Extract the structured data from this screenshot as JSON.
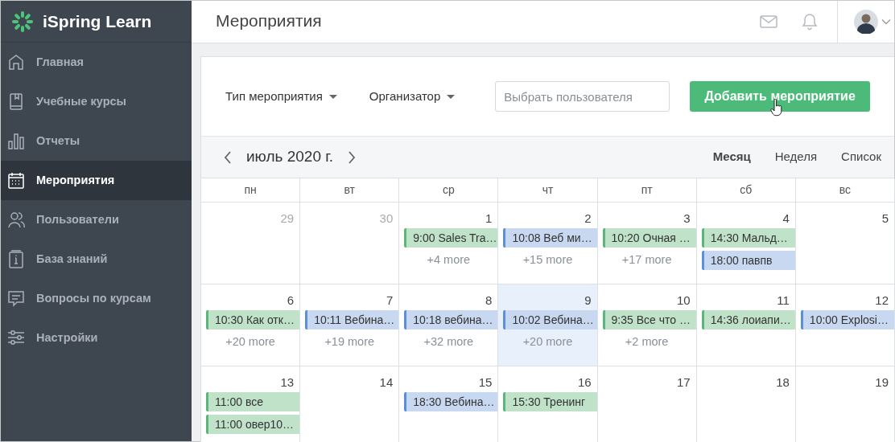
{
  "sidebar": {
    "logo": "iSpring Learn",
    "items": [
      {
        "label": "Главная",
        "selected": false
      },
      {
        "label": "Учебные курсы",
        "selected": false
      },
      {
        "label": "Отчеты",
        "selected": false
      },
      {
        "label": "Мероприятия",
        "selected": true
      },
      {
        "label": "Пользователи",
        "selected": false
      },
      {
        "label": "База знаний",
        "selected": false
      },
      {
        "label": "Вопросы по курсам",
        "selected": false
      },
      {
        "label": "Настройки",
        "selected": false
      }
    ]
  },
  "header": {
    "title": "Мероприятия"
  },
  "toolbar": {
    "filters": [
      {
        "label": "Тип мероприятия"
      },
      {
        "label": "Организатор"
      }
    ],
    "search": {
      "placeholder": "Выбрать пользователя"
    },
    "add_button": "Добавить мероприятие"
  },
  "calendar": {
    "month": "июль 2020 г.",
    "views": [
      {
        "label": "Месяц",
        "selected": true
      },
      {
        "label": "Неделя",
        "selected": false
      },
      {
        "label": "Список",
        "selected": false
      }
    ],
    "weekdays": [
      "пн",
      "вт",
      "ср",
      "чт",
      "пт",
      "сб",
      "вс"
    ],
    "weeks": [
      {
        "days": [
          {
            "number": "29",
            "other_month": true,
            "today": false
          },
          {
            "number": "30",
            "other_month": true,
            "today": false
          },
          {
            "number": "1",
            "other_month": false,
            "today": false,
            "events": [
              {
                "text": "9:00 Sales Tra…",
                "color": "#5cb57a"
              }
            ],
            "more": "+4 more"
          },
          {
            "number": "2",
            "other_month": false,
            "today": false,
            "events": [
              {
                "text": "10:08 Веб ми…",
                "color": "#5b8fd9"
              }
            ],
            "more": "+15 more"
          },
          {
            "number": "3",
            "other_month": false,
            "today": false,
            "events": [
              {
                "text": "10:20 Очная …",
                "color": "#5cb57a"
              }
            ],
            "more": "+17 more"
          },
          {
            "number": "4",
            "other_month": false,
            "today": false,
            "events": [
              {
                "text": "14:30 Мальд…",
                "color": "#5cb57a"
              },
              {
                "text": "18:00 павпв",
                "color": "#5b8fd9"
              }
            ]
          },
          {
            "number": "5",
            "other_month": false,
            "today": false
          }
        ]
      },
      {
        "days": [
          {
            "number": "6",
            "other_month": false,
            "today": false,
            "events": [
              {
                "text": "10:30 Как отк…",
                "color": "#5cb57a"
              }
            ],
            "more": "+20 more"
          },
          {
            "number": "7",
            "other_month": false,
            "today": false,
            "events": [
              {
                "text": "10:11 Вебина…",
                "color": "#5b8fd9"
              }
            ],
            "more": "+19 more"
          },
          {
            "number": "8",
            "other_month": false,
            "today": false,
            "events": [
              {
                "text": "10:18 вебина…",
                "color": "#5b8fd9"
              }
            ],
            "more": "+32 more"
          },
          {
            "number": "9",
            "other_month": false,
            "today": true,
            "events": [
              {
                "text": "10:02 Вебина…",
                "color": "#5b8fd9"
              }
            ],
            "more": "+20 more"
          },
          {
            "number": "10",
            "other_month": false,
            "today": false,
            "events": [
              {
                "text": "9:35 Все что …",
                "color": "#5cb57a"
              }
            ],
            "more": "+2 more"
          },
          {
            "number": "11",
            "other_month": false,
            "today": false,
            "events": [
              {
                "text": "14:36 лоиапи…",
                "color": "#5cb57a"
              }
            ]
          },
          {
            "number": "12",
            "other_month": false,
            "today": false,
            "events": [
              {
                "text": "10:00 Explosi…",
                "color": "#5b8fd9"
              }
            ]
          }
        ]
      },
      {
        "days": [
          {
            "number": "13",
            "other_month": false,
            "today": false,
            "events": [
              {
                "text": "11:00 все",
                "color": "#5cb57a"
              },
              {
                "text": "11:00 овер10…",
                "color": "#5cb57a"
              }
            ]
          },
          {
            "number": "14",
            "other_month": false,
            "today": false
          },
          {
            "number": "15",
            "other_month": false,
            "today": false,
            "events": [
              {
                "text": "18:30 Вебина…",
                "color": "#5b8fd9"
              }
            ]
          },
          {
            "number": "16",
            "other_month": false,
            "today": false,
            "events": [
              {
                "text": "15:30 Тренинг",
                "color": "#5cb57a"
              }
            ]
          },
          {
            "number": "17",
            "other_month": false,
            "today": false
          },
          {
            "number": "18",
            "other_month": false,
            "today": false
          },
          {
            "number": "19",
            "other_month": false,
            "today": false
          }
        ]
      }
    ]
  }
}
